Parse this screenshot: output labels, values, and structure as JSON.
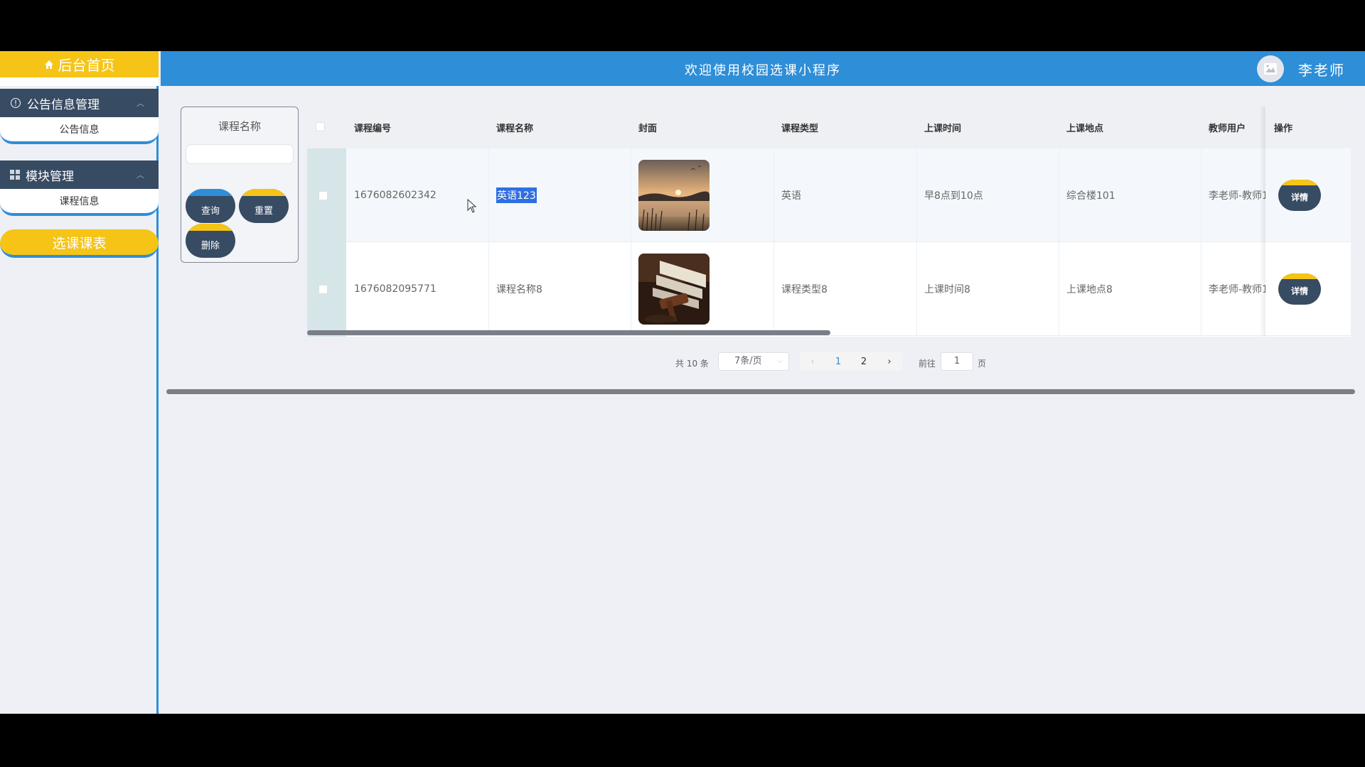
{
  "sidebar": {
    "home_label": "后台首页",
    "menus": [
      {
        "label": "公告信息管理",
        "icon": "info-circle-icon",
        "items": [
          "公告信息"
        ]
      },
      {
        "label": "模块管理",
        "icon": "grid-icon",
        "items": [
          "课程信息"
        ]
      }
    ],
    "active_item": "选课课表"
  },
  "header": {
    "title": "欢迎使用校园选课小程序",
    "user_name": "李老师",
    "avatar_icon": "image-placeholder-icon"
  },
  "search": {
    "label": "课程名称",
    "value": "",
    "query_label": "查询",
    "reset_label": "重置",
    "delete_label": "删除"
  },
  "table": {
    "columns": [
      "课程编号",
      "课程名称",
      "封面",
      "课程类型",
      "上课时间",
      "上课地点",
      "教师用户",
      "操作"
    ],
    "rows": [
      {
        "id": "1676082602342",
        "name": "英语123",
        "cover": "sunset-lake-image",
        "type": "英语",
        "time": "早8点到10点",
        "place": "综合楼101",
        "teacher": "李老师-教师1",
        "action": "详情"
      },
      {
        "id": "1676082095771",
        "name": "课程名称8",
        "cover": "books-gavel-image",
        "type": "课程类型8",
        "time": "上课时间8",
        "place": "上课地点8",
        "teacher": "李老师-教师1",
        "action": "详情"
      }
    ]
  },
  "pagination": {
    "total": "共 10 条",
    "page_size": "7条/页",
    "pages": [
      "1",
      "2"
    ],
    "current": "1",
    "goto_label": "前往",
    "goto_value": "1",
    "goto_unit": "页"
  },
  "colors": {
    "primary_blue": "#2e8ed8",
    "accent_yellow": "#f5c416",
    "dark_navy": "#374b63"
  }
}
